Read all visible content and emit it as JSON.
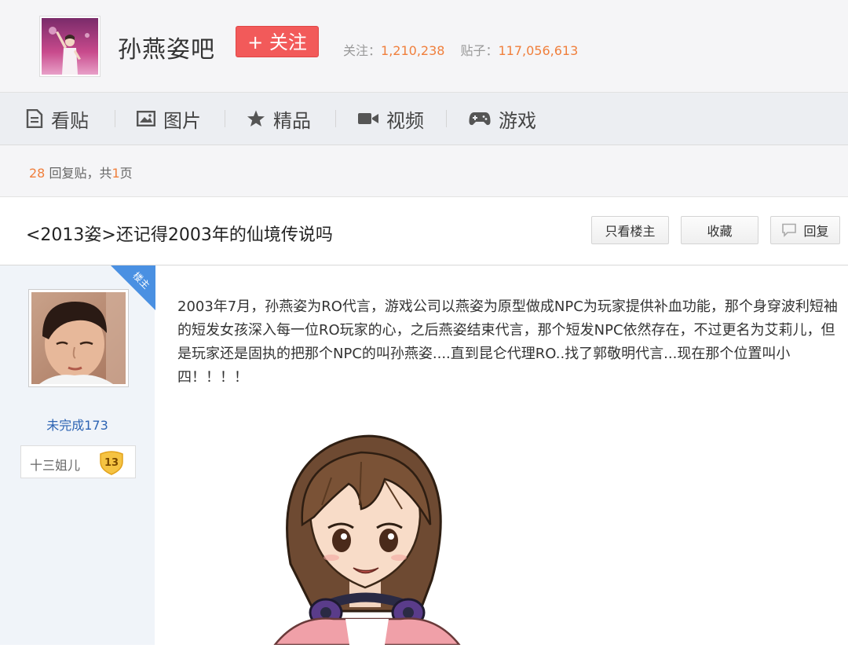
{
  "forum": {
    "name": "孙燕姿吧",
    "follow_label": "+ 关注",
    "followers_label": "关注：",
    "followers_value": "1,210,238",
    "posts_label": "贴子：",
    "posts_value": "117,056,613"
  },
  "nav": [
    {
      "label": "看贴",
      "icon": "document-icon"
    },
    {
      "label": "图片",
      "icon": "image-icon"
    },
    {
      "label": "精品",
      "icon": "star-icon"
    },
    {
      "label": "视频",
      "icon": "video-icon"
    },
    {
      "label": "游戏",
      "icon": "gamepad-icon"
    }
  ],
  "reply_bar": {
    "count": "28",
    "count_suffix": " 回复贴，共",
    "pages": "1",
    "pages_suffix": "页"
  },
  "thread": {
    "title": "<2013姿>还记得2003年的仙境传说吗",
    "buttons": {
      "only_op": "只看楼主",
      "favorite": "收藏",
      "reply": "回复"
    }
  },
  "post": {
    "op_tag": "楼主",
    "username": "未完成173",
    "badge_label": "十三姐儿",
    "badge_level": "13",
    "content": "2003年7月，孙燕姿为RO代言，游戏公司以燕姿为原型做成NPC为玩家提供补血功能，那个身穿波利短袖的短发女孩深入每一位RO玩家的心，之后燕姿结束代言，那个短发NPC依然存在，不过更名为艾莉儿，但是玩家还是固执的把那个NPC的叫孙燕姿....直到昆仑代理RO..找了郭敬明代言...现在那个位置叫小四！！！！"
  },
  "colors": {
    "accent_orange": "#f07f3c",
    "follow_red": "#f25a5a",
    "link_blue": "#2d64b3",
    "op_ribbon": "#4a90e2",
    "badge_gold": "#f5c342"
  }
}
